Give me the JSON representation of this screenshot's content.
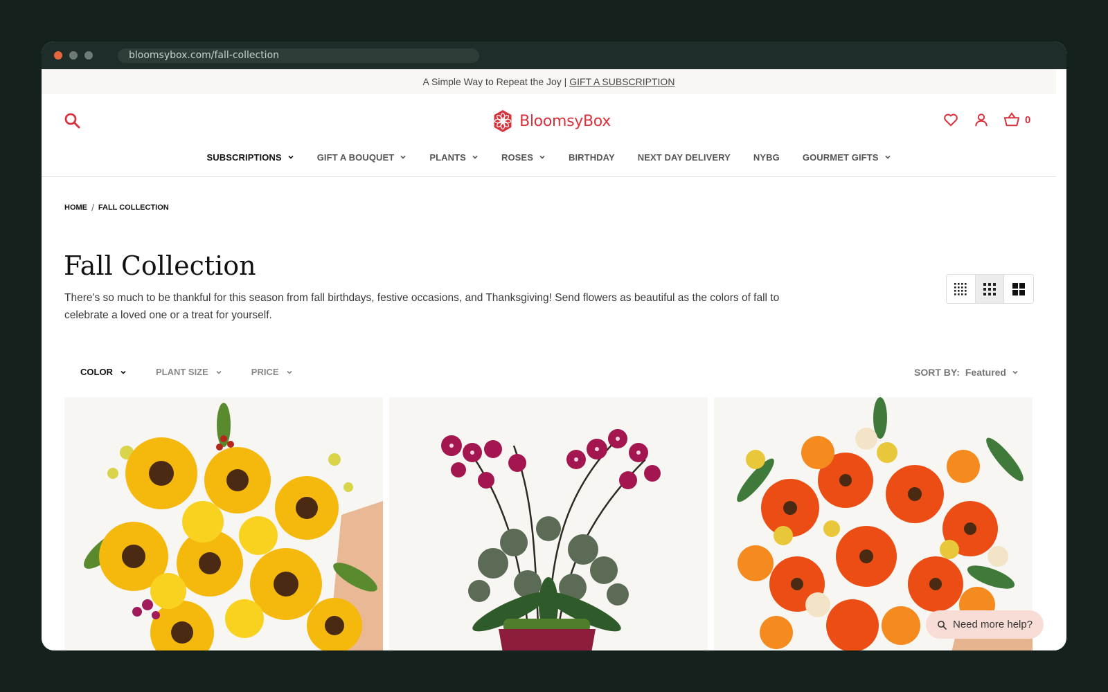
{
  "browser": {
    "url": "bloomsybox.com/fall-collection"
  },
  "promo": {
    "text": "A Simple Way to Repeat the Joy |",
    "link": "GIFT A SUBSCRIPTION"
  },
  "header": {
    "logo_text": "BloomsyBox",
    "cart_count": "0"
  },
  "nav": [
    {
      "label": "SUBSCRIPTIONS",
      "has_menu": true
    },
    {
      "label": "GIFT A BOUQUET",
      "has_menu": true
    },
    {
      "label": "PLANTS",
      "has_menu": true
    },
    {
      "label": "ROSES",
      "has_menu": true
    },
    {
      "label": "BIRTHDAY",
      "has_menu": false
    },
    {
      "label": "NEXT DAY DELIVERY",
      "has_menu": false
    },
    {
      "label": "NYBG",
      "has_menu": false
    },
    {
      "label": "GOURMET GIFTS",
      "has_menu": true
    }
  ],
  "breadcrumb": [
    "HOME",
    "/",
    "FALL COLLECTION"
  ],
  "page": {
    "title": "Fall Collection",
    "description": "There's so much to be thankful for this season from fall birthdays, festive occasions, and Thanksgiving! Send flowers as beautiful as the colors of fall to celebrate a loved one or a treat for yourself."
  },
  "filters": [
    "COLOR",
    "PLANT SIZE",
    "PRICE"
  ],
  "sort": {
    "label": "SORT BY:",
    "value": "Featured"
  },
  "help": {
    "label": "Need more help?"
  },
  "colors": {
    "brand": "#d8323d",
    "bg": "#14211d",
    "chrome": "#1e2d29"
  }
}
